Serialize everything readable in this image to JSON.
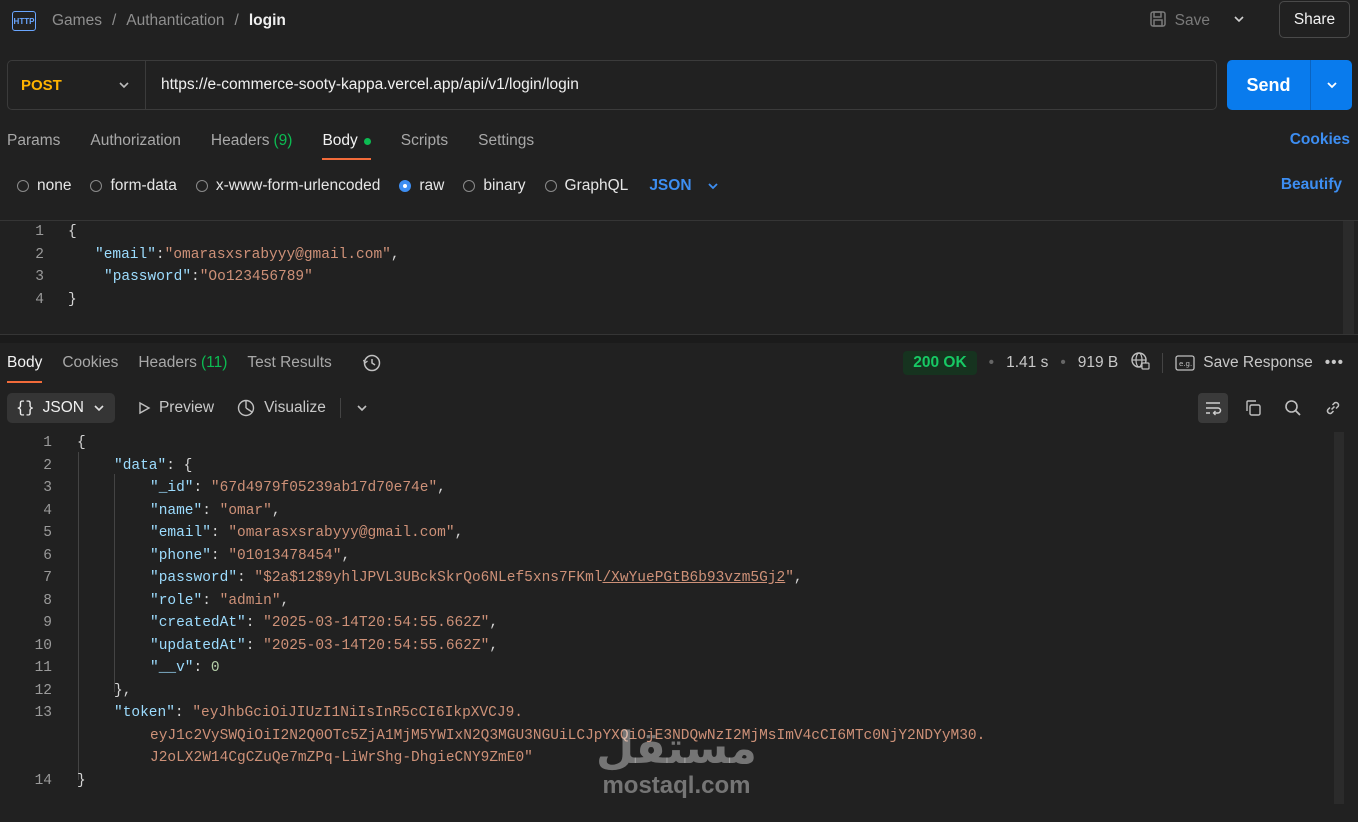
{
  "header": {
    "breadcrumb": [
      "Games",
      "Authantication"
    ],
    "current": "login",
    "save_label": "Save",
    "share_label": "Share"
  },
  "request": {
    "method": "POST",
    "url": "https://e-commerce-sooty-kappa.vercel.app/api/v1/login/login",
    "send_label": "Send",
    "tabs": {
      "params": "Params",
      "authorization": "Authorization",
      "headers": "Headers",
      "headers_count": "(9)",
      "body": "Body",
      "scripts": "Scripts",
      "settings": "Settings"
    },
    "cookies_label": "Cookies",
    "body_types": {
      "none": "none",
      "form_data": "form-data",
      "urlencoded": "x-www-form-urlencoded",
      "raw": "raw",
      "binary": "binary",
      "graphql": "GraphQL"
    },
    "format": "JSON",
    "beautify_label": "Beautify",
    "body_lines": {
      "n1": "1",
      "n2": "2",
      "n3": "3",
      "n4": "4",
      "open": "{",
      "email_key": "\"email\"",
      "email_val": "\"omarasxsrabyyy@gmail.com\"",
      "password_key": "\"password\"",
      "password_val": "\"Oo123456789\"",
      "close": "}"
    }
  },
  "response": {
    "tabs": {
      "body": "Body",
      "cookies": "Cookies",
      "headers": "Headers",
      "headers_count": "(11)",
      "test_results": "Test Results"
    },
    "status": "200 OK",
    "time": "1.41 s",
    "size": "919 B",
    "save_response": "Save Response",
    "view_format": "JSON",
    "preview_label": "Preview",
    "visualize_label": "Visualize",
    "body": {
      "n1": "1",
      "n2": "2",
      "n3": "3",
      "n4": "4",
      "n5": "5",
      "n6": "6",
      "n7": "7",
      "n8": "8",
      "n9": "9",
      "n10": "10",
      "n11": "11",
      "n12": "12",
      "n13": "13",
      "n14": "14",
      "id_val": "\"67d4979f05239ab17d70e74e\"",
      "name_val": "\"omar\"",
      "email_val": "\"omarasxsrabyyy@gmail.com\"",
      "phone_val": "\"01013478454\"",
      "password_val_a": "\"$2a$12$9yhlJPVL3UBckSkrQo6NLef5xns7FKml",
      "password_val_b": "/XwYuePGtB6b93vzm5Gj2",
      "password_val_c": "\"",
      "role_val": "\"admin\"",
      "created_val": "\"2025-03-14T20:54:55.662Z\"",
      "updated_val": "\"2025-03-14T20:54:55.662Z\"",
      "v_val": "0",
      "token_1": "\"eyJhbGciOiJIUzI1NiIsInR5cCI6IkpXVCJ9.",
      "token_2": "eyJ1c2VySWQiOiI2N2Q0OTc5ZjA1MjM5YWIxN2Q3MGU3NGUiLCJpYXQiOjE3NDQwNzI2MjMsImV4cCI6MTc0NjY2NDYyM30.",
      "token_3": "J2oLX2W14CgCZuQe7mZPq-LiWrShg-DhgieCNY9ZmE0\""
    }
  },
  "watermark": {
    "arabic": "مستقل",
    "latin": "mostaql.com"
  },
  "colors": {
    "background": "#212121",
    "accent_orange": "#f26b3a",
    "send_blue": "#097bed",
    "link_blue": "#3d8ef2",
    "method_yellow": "#ffb400",
    "status_green": "#17c964"
  }
}
